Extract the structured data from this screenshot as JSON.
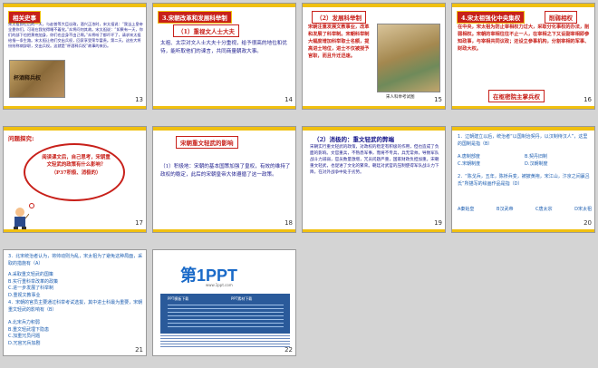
{
  "slides": [
    {
      "num": "13",
      "tag": "相关史事",
      "pic_caption": "",
      "text": "宋太祖即位后的一天，与赵普等大臣议政，酒兴正浓时，宋太祖说：“我当上皇帝全靠你们，可现在我觉得睡不着觉。”众将问何其故。宋太祖说：“如果有一天，你们的部下也把黄袍加身，你们也会身不由己啊。”众将听了都吓坏了，请求宋太祖给指一条生路。宋太祖让他们交出兵权，回家享受荣华富贵。第二天，这些大将纷纷称病辞职，交出兵权。这就是“杯酒释兵权”故事的来历。",
      "pic_label": "杯酒释兵权"
    },
    {
      "num": "14",
      "tag": "3.宋朝改革和发展科举制",
      "sub": "（1）重视文人士大夫",
      "text": "太祖、太宗对文人士大夫十分重视，给予很高的地位和优待，能听取他们的谏言，共同商量朝政大事。"
    },
    {
      "num": "15",
      "tag": "（2）发展科举制",
      "text": "宋朝注重发展文教事业，改革和发展了科举制。宋朝科举制大幅度增加科举取士名额，提高进士地位，进士不仅被授予官职，而且升迁迅速。",
      "pic_caption": "宋人科举考试图"
    },
    {
      "num": "16",
      "tag": "4.宋太祖强化中央集权",
      "tag2": "削弱相权",
      "text": "在中央，宋太祖为防止宰相权力过大，采取分化事权的办法，削弱相权。宋朝的宰相往往不止一人，在宰相之下又设副宰相即参知政事，与宰相共同议政；还设立参事机构，分割宰相的军事、财政大权。",
      "tag3": "在枢密院主掌兵权"
    },
    {
      "num": "17",
      "tag": "问题探究:",
      "bubble": "阅读课文后，自己思考，宋朝重文轻武的政策有什么影响？（P37积极、消极的）"
    },
    {
      "num": "18",
      "tag": "宋朝重文轻武的影响",
      "text": "（1）积极地：宋朝的基本国策加强了皇权，有效的维持了政权的稳定，此后的宋朝皇帝大体遵循了这一政策。"
    },
    {
      "num": "19",
      "tag": "（2）消极的：重文轻武的弊端",
      "text": "宋朝实行重文轻武的政策，对政权的稳定有积极的作用，但也造成了负面的影响。文官重兵，不熟悉军事，而将不专兵，兵无常帅，导致军队战斗力减弱，官员数量激增，冗员问题严重，国家财政负担加重。宋朝重文轻武，也促进了文化的繁荣。朝廷对武官的压制使得军队战斗力下降，在对外战争中处于劣势。"
    },
    {
      "num": "20",
      "q1": "1．辽朝建立以后，统治者“以国制治契丹，以汉制待汉人”，这里的国制是指（B）",
      "q1_opts": [
        "A.唐制部度",
        "B.契丹旧制",
        "C.宋朝制度",
        "D.汉朝制度"
      ],
      "q2": "2．“陈戈兵，五年，陈桥兵变，被披黄袍，宋江山，汴京之间嬴吕氏”所描写的绘画作品是指（D）",
      "q2_opts": [
        "A秦始皇",
        "B汉武帝",
        "C唐太宗",
        "D宋太祖"
      ]
    },
    {
      "num": "21",
      "q3": "3．北宋统治者认为，将帅动则为乱，宋太祖为了避免这种局面，采取的措施有（A）",
      "q3_opts": [
        "A.采取重文轻武的国策",
        "B.实行重科举改革的政策",
        "C.进一步发展了科举制",
        "D.重视文教事业"
      ],
      "q4": "4．宋朝的官员主要通过科举考试选拔，其中进士科最为重要，宋朝重文轻武的影响有（B）",
      "q4_opts": [
        "A.北宋兵力积弱",
        "B.重文轻武埋下隐患",
        "C.加重冗员问题",
        "D.冗官冗兵加剧"
      ]
    },
    {
      "num": "22",
      "logo": "第1PPT",
      "logo_sub": "www.1ppt.com",
      "col1": "PPT模板下载",
      "col2": "PPT素材下载"
    }
  ],
  "colors": {
    "accent_red": "#c8201a",
    "accent_yellow": "#f0c010",
    "text_blue": "#1a1a8c",
    "link_blue": "#1a5cb0"
  }
}
